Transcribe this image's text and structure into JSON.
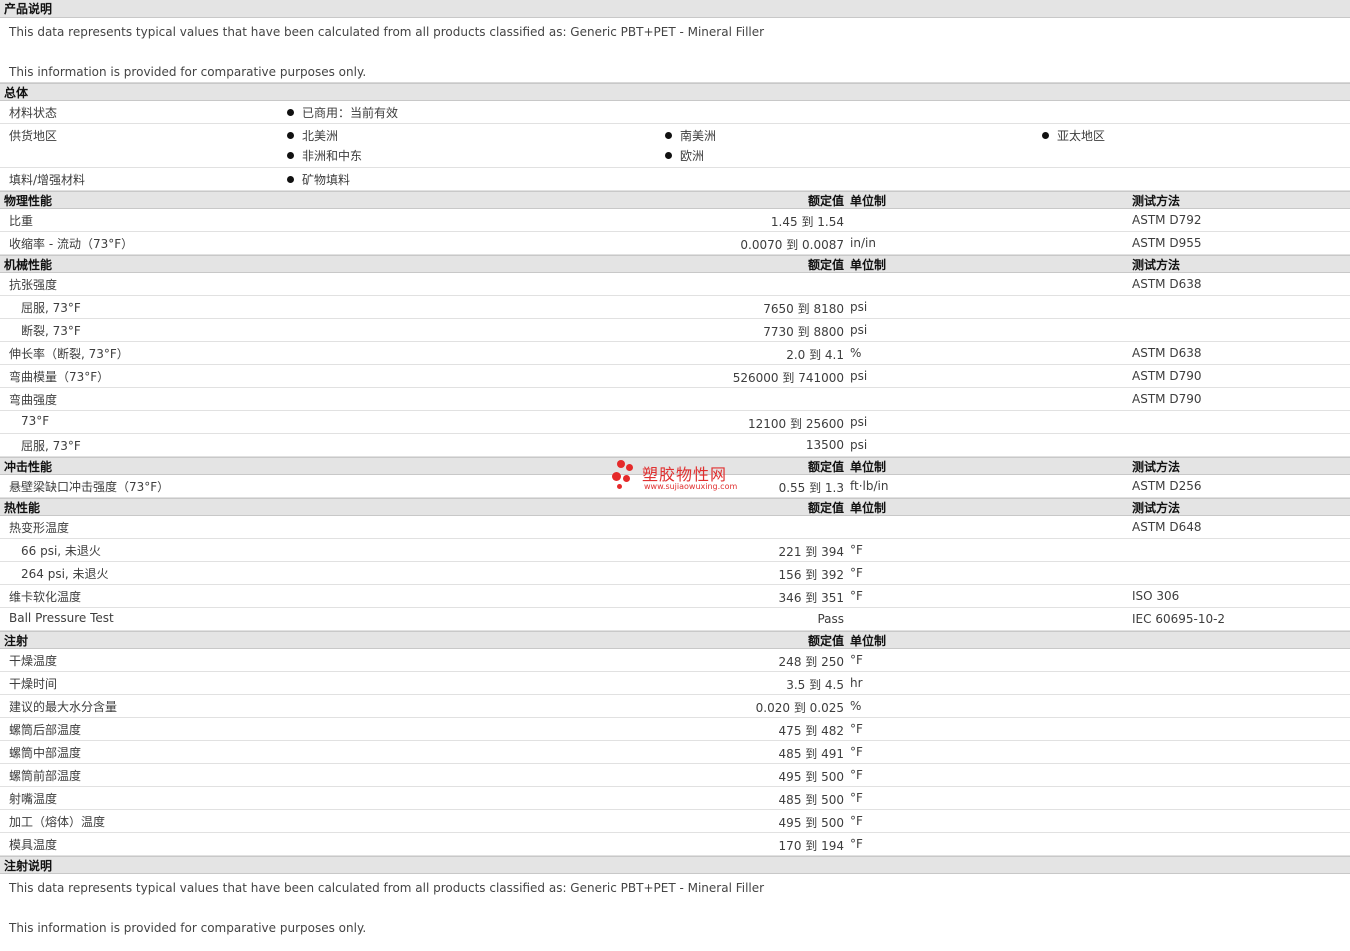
{
  "product_desc": {
    "title": "产品说明",
    "line1": "This data represents typical values that have been calculated from all products classified as: Generic PBT+PET - Mineral Filler",
    "line2": "This information is provided for comparative purposes only."
  },
  "general": {
    "title": "总体",
    "material_status_label": "材料状态",
    "material_status_value": "已商用：当前有效",
    "supply_label": "供货地区",
    "supply_regions": [
      "北美洲",
      "南美洲",
      "亚太地区",
      "非洲和中东",
      "欧洲"
    ],
    "filler_label": "填料/增强材料",
    "filler_value": "矿物填料"
  },
  "col_headers": {
    "nominal": "额定值",
    "unit": "单位制",
    "test": "测试方法"
  },
  "physical": {
    "title": "物理性能",
    "rows": [
      {
        "label": "比重",
        "value": "1.45 到  1.54",
        "unit": "",
        "test": "ASTM D792"
      },
      {
        "label": "收缩率  - 流动（73°F）",
        "value": "0.0070 到  0.0087",
        "unit": "in/in",
        "test": "ASTM D955"
      }
    ]
  },
  "mechanical": {
    "title": "机械性能",
    "rows": [
      {
        "label": "抗张强度",
        "value": "",
        "unit": "",
        "test": "ASTM D638"
      },
      {
        "label": "屈服, 73°F",
        "value": "7650 到  8180",
        "unit": "psi",
        "test": ""
      },
      {
        "label": "断裂, 73°F",
        "value": "7730 到  8800",
        "unit": "psi",
        "test": ""
      },
      {
        "label": "伸长率（断裂, 73°F）",
        "value": "2.0 到  4.1",
        "unit": "%",
        "test": "ASTM D638"
      },
      {
        "label": "弯曲模量（73°F）",
        "value": "526000 到  741000",
        "unit": "psi",
        "test": "ASTM D790"
      },
      {
        "label": "弯曲强度",
        "value": "",
        "unit": "",
        "test": "ASTM D790"
      },
      {
        "label": "73°F",
        "value": "12100 到  25600",
        "unit": "psi",
        "test": ""
      },
      {
        "label": "屈服, 73°F",
        "value": "13500",
        "unit": "psi",
        "test": ""
      }
    ]
  },
  "impact": {
    "title": "冲击性能",
    "rows": [
      {
        "label": "悬壁梁缺口冲击强度（73°F）",
        "value": "0.55 到  1.3",
        "unit": "ft·lb/in",
        "test": "ASTM D256"
      }
    ]
  },
  "thermal": {
    "title": "热性能",
    "rows": [
      {
        "label": "热变形温度",
        "value": "",
        "unit": "",
        "test": "ASTM D648"
      },
      {
        "label": "66 psi, 未退火",
        "value": "221 到  394",
        "unit": "°F",
        "test": ""
      },
      {
        "label": "264 psi, 未退火",
        "value": "156 到  392",
        "unit": "°F",
        "test": ""
      },
      {
        "label": "维卡软化温度",
        "value": "346 到  351",
        "unit": "°F",
        "test": "ISO 306"
      },
      {
        "label": "Ball Pressure Test",
        "value": "Pass",
        "unit": "",
        "test": "IEC 60695-10-2"
      }
    ]
  },
  "injection": {
    "title": "注射",
    "rows": [
      {
        "label": "干燥温度",
        "value": "248 到  250",
        "unit": "°F"
      },
      {
        "label": "干燥时间",
        "value": "3.5 到  4.5",
        "unit": "hr"
      },
      {
        "label": "建议的最大水分含量",
        "value": "0.020 到  0.025",
        "unit": "%"
      },
      {
        "label": "螺筒后部温度",
        "value": "475 到  482",
        "unit": "°F"
      },
      {
        "label": "螺筒中部温度",
        "value": "485 到  491",
        "unit": "°F"
      },
      {
        "label": "螺筒前部温度",
        "value": "495 到  500",
        "unit": "°F"
      },
      {
        "label": "射嘴温度",
        "value": "485 到  500",
        "unit": "°F"
      },
      {
        "label": "加工（熔体）温度",
        "value": "495 到  500",
        "unit": "°F"
      },
      {
        "label": "模具温度",
        "value": "170 到  194",
        "unit": "°F"
      }
    ]
  },
  "injection_notes": {
    "title": "注射说明",
    "line1": "This data represents typical values that have been calculated from all products classified as: Generic PBT+PET - Mineral Filler",
    "line2": "This information is provided for comparative purposes only."
  },
  "watermark": {
    "text": "塑胶物性网",
    "url": "www.sujiaowuxing.com"
  }
}
